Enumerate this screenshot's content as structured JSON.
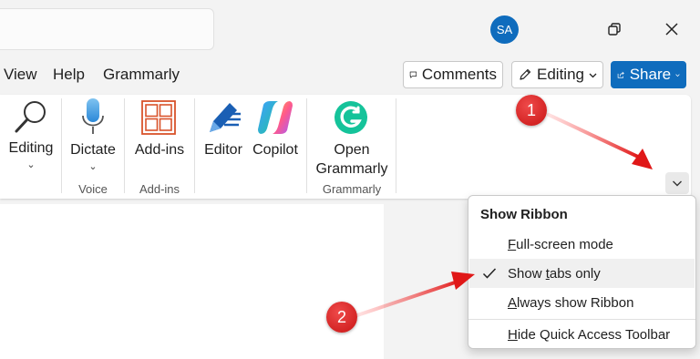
{
  "titlebar": {
    "avatar_initials": "SA"
  },
  "tabs": [
    "View",
    "Help",
    "Grammarly"
  ],
  "top_buttons": {
    "comments": "Comments",
    "editing": "Editing",
    "share": "Share"
  },
  "ribbon": {
    "editing_label": "Editing",
    "dictate_label": "Dictate",
    "voice_group": "Voice",
    "addins_label": "Add-ins",
    "addins_group": "Add-ins",
    "editor_label": "Editor",
    "copilot_label": "Copilot",
    "open_grammarly_line1": "Open",
    "open_grammarly_line2": "Grammarly",
    "grammarly_group": "Grammarly"
  },
  "menu": {
    "title": "Show Ribbon",
    "items": [
      {
        "first": "F",
        "rest": "ull-screen mode",
        "checked": false
      },
      {
        "pre": "Show ",
        "first": "t",
        "rest": "abs only",
        "checked": true
      },
      {
        "first": "A",
        "rest": "lways show Ribbon",
        "checked": false
      },
      {
        "first": "H",
        "rest": "ide Quick Access Toolbar",
        "checked": false
      }
    ]
  },
  "annotations": {
    "badge1": "1",
    "badge2": "2"
  },
  "colors": {
    "accent": "#0f6cbd",
    "badge_red": "#d61a1a",
    "addins_orange": "#d9532b",
    "grammarly_green": "#15c39a"
  }
}
